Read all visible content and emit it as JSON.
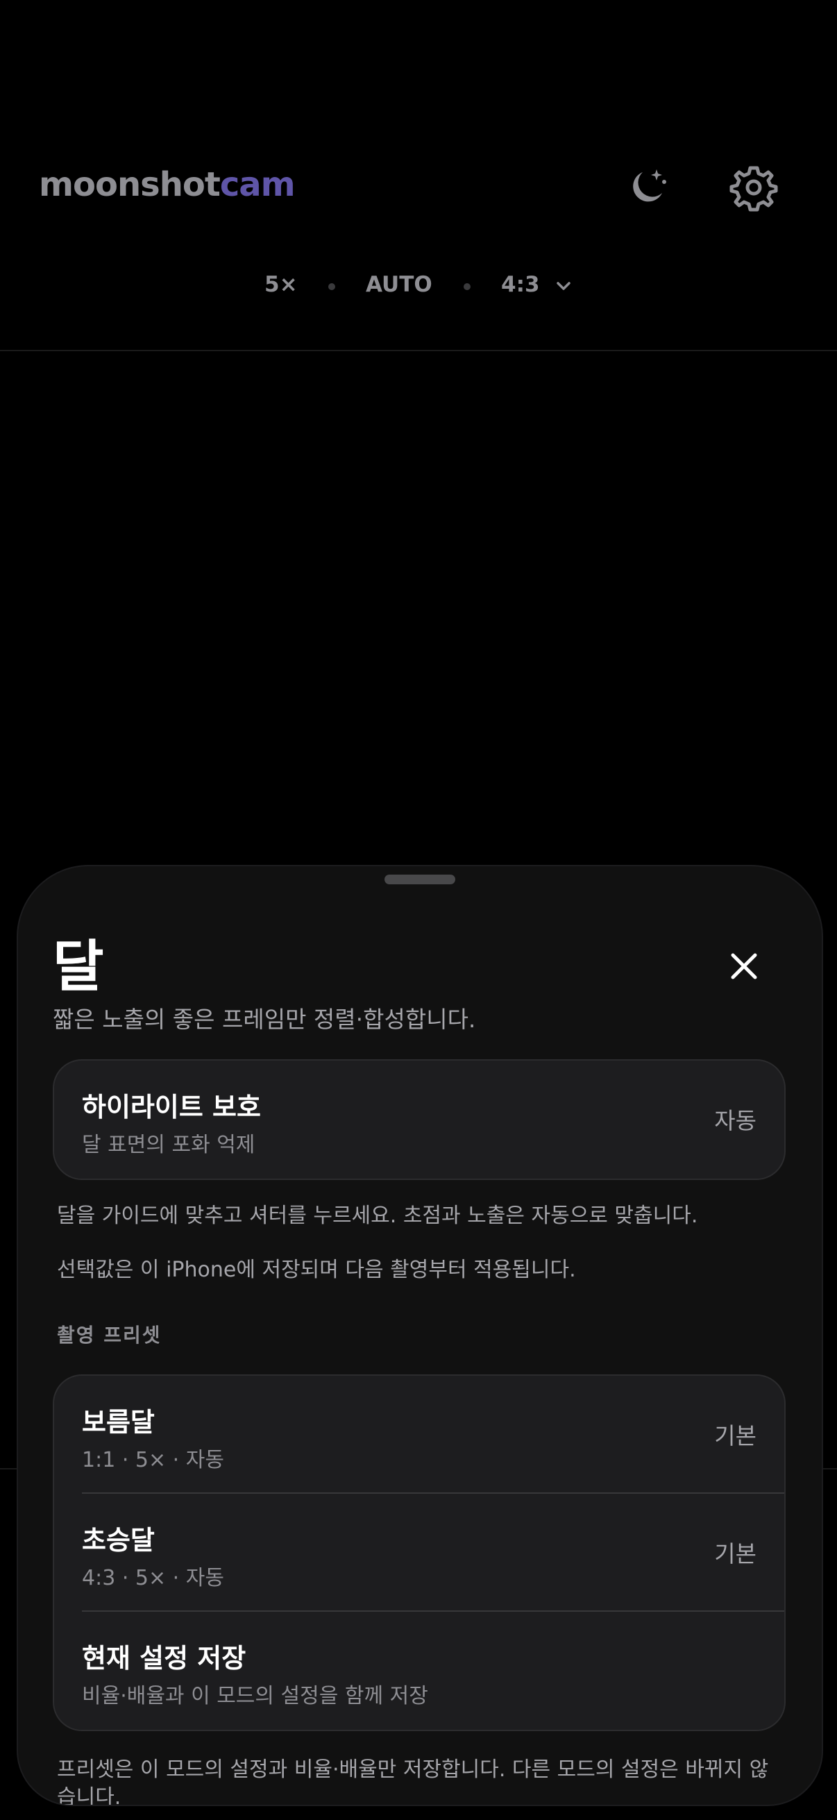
{
  "app": {
    "brand_part1": "moonshot",
    "brand_part2": "cam"
  },
  "top_icons": {
    "night": "moon-stars-icon",
    "settings": "gear-icon"
  },
  "status": {
    "zoom": "5×",
    "mode": "AUTO",
    "ratio": "4:3"
  },
  "sheet": {
    "title": "달",
    "subtitle": "짧은 노출의 좋은 프레임만 정렬·합성합니다.",
    "highlight": {
      "title": "하이라이트 보호",
      "subtitle": "달 표면의 포화 억제",
      "value": "자동"
    },
    "guide_text": "달을 가이드에 맞추고 셔터를 누르세요. 초점과 노출은 자동으로 맞춥니다.",
    "storage_note": "선택값은 이 iPhone에 저장되며 다음 촬영부터 적용됩니다.",
    "presets_header": "촬영 프리셋",
    "presets": [
      {
        "title": "보름달",
        "subtitle": "1:1 · 5× · 자동",
        "value": "기본"
      },
      {
        "title": "초승달",
        "subtitle": "4:3 · 5× · 자동",
        "value": "기본"
      },
      {
        "title": "현재 설정 저장",
        "subtitle": "비율·배율과 이 모드의 설정을 함께 저장",
        "value": ""
      }
    ],
    "footer_note": "프리셋은 이 모드의 설정과 비율·배율만 저장합니다. 다른 모드의 설정은 바뀌지 않습니다."
  },
  "colors": {
    "accent": "#5f55a8",
    "sheet_bg": "#111111",
    "card_bg": "#1d1d1f"
  }
}
